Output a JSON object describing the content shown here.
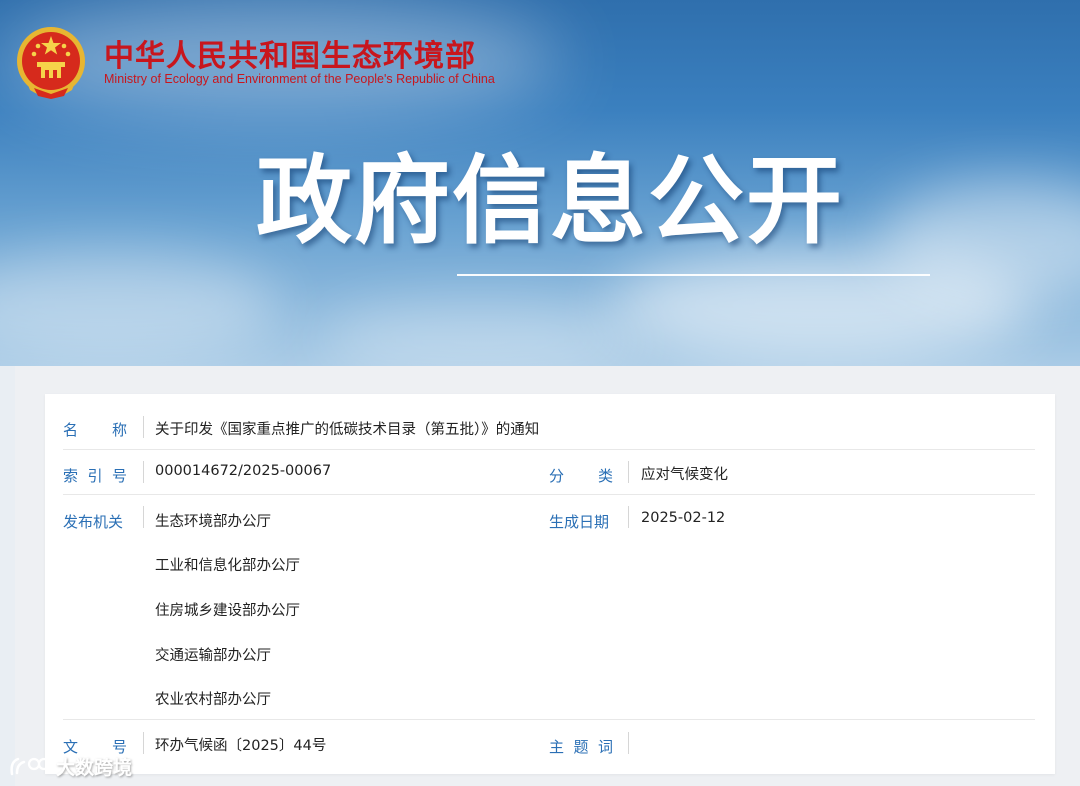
{
  "header": {
    "org_name_cn": "中华人民共和国生态环境部",
    "org_name_en": "Ministry of Ecology and Environment of the People's Republic of China",
    "emblem_icon": "national-emblem-icon",
    "banner_title": "政府信息公开"
  },
  "info": {
    "name_label": [
      "名",
      "称"
    ],
    "name_value": "关于印发《国家重点推广的低碳技术目录（第五批）》的通知",
    "index_label": [
      "索",
      "引",
      "号"
    ],
    "index_value": "000014672/2025-00067",
    "category_label": [
      "分",
      "类"
    ],
    "category_value": "应对气候变化",
    "issuer_label": "发布机关",
    "issuers": [
      "生态环境部办公厅",
      "工业和信息化部办公厅",
      "住房城乡建设部办公厅",
      "交通运输部办公厅",
      "农业农村部办公厅"
    ],
    "date_label": "生成日期",
    "date_value": "2025-02-12",
    "docno_label": [
      "文",
      "号"
    ],
    "docno_value": "环办气候函〔2025〕44号",
    "keywords_label": [
      "主",
      "题",
      "词"
    ],
    "keywords_value": ""
  },
  "watermark": {
    "text": "大数跨境"
  },
  "colors": {
    "brand_red": "#c8161d",
    "label_blue": "#2a6fb5",
    "text_dark": "#222222"
  }
}
